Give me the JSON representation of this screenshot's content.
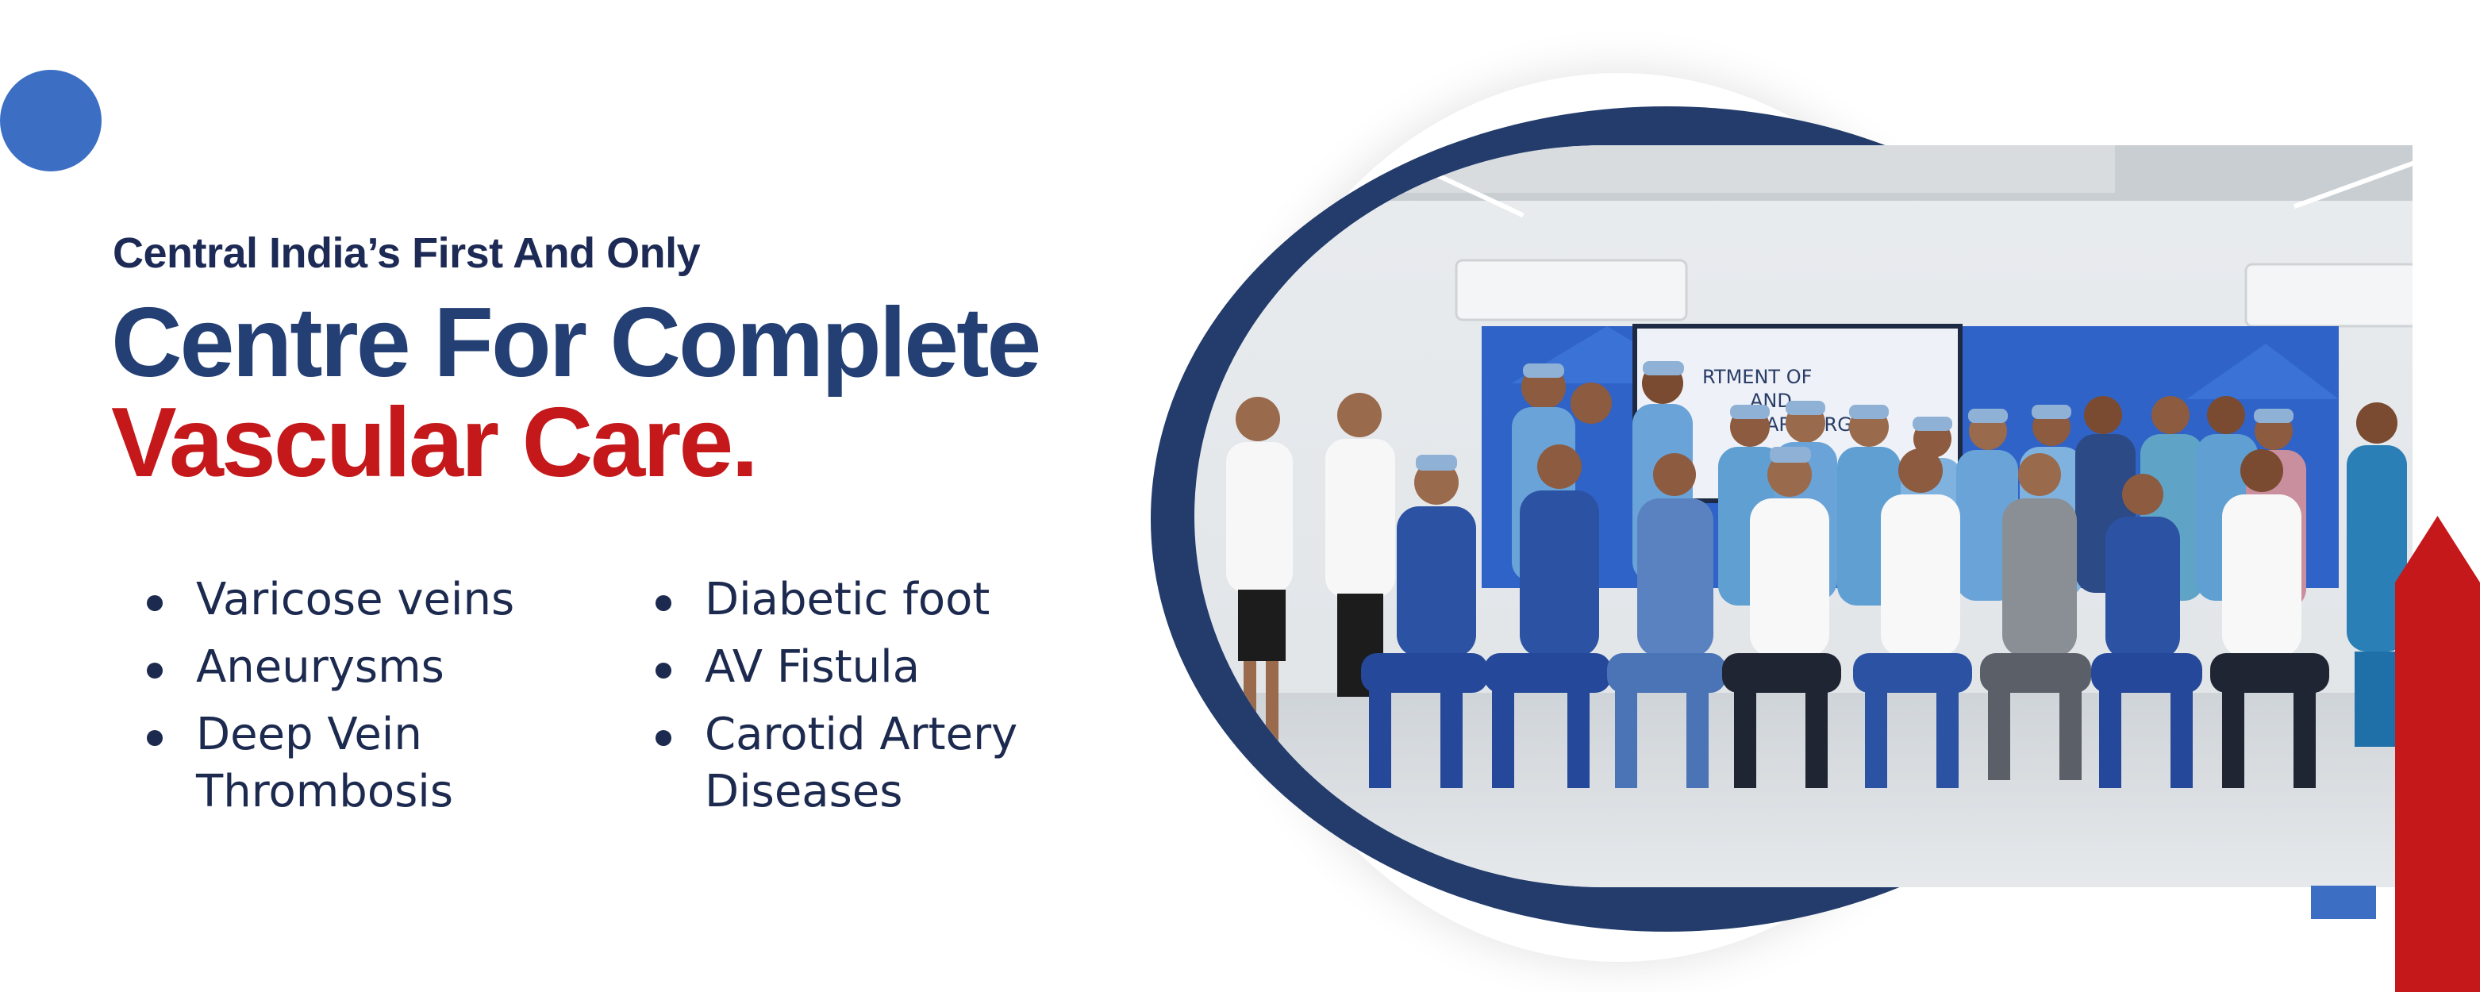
{
  "kicker": "Central India’s First And Only",
  "headline": {
    "line1": "Centre For Complete",
    "line2": "Vascular Care."
  },
  "conditions_left": [
    "Varicose veins",
    "Aneurysms",
    "Deep Vein\nThrombosis"
  ],
  "conditions_right": [
    "Diabetic foot",
    "AV Fistula",
    "Carotid Artery\n Diseases"
  ],
  "colors": {
    "navy": "#233f73",
    "red": "#c4181b",
    "accent_blue": "#3c6fc4"
  },
  "photo": {
    "subject": "team-group-photo",
    "screen_text": [
      "RTMENT OF",
      "AND",
      "AR SURG"
    ]
  }
}
